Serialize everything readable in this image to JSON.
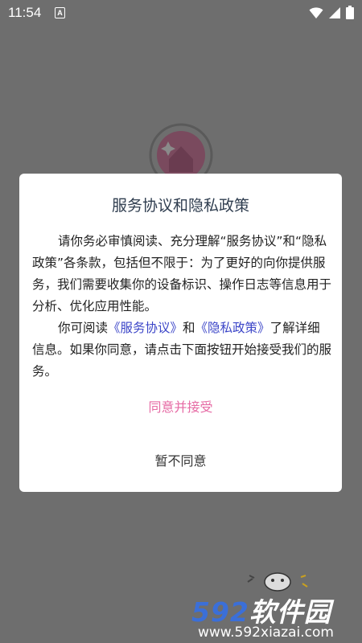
{
  "status_bar": {
    "time": "11:54",
    "notification_badge": "A",
    "icons": [
      "notification-a-icon",
      "wifi-icon",
      "signal-icon",
      "battery-icon"
    ]
  },
  "dialog": {
    "title": "服务协议和隐私政策",
    "para1": "请你务必审慎阅读、充分理解“服务协议”和“隐私政策”各条款，包括但不限于：为了更好的向你提供服务，我们需要收集你的设备标识、操作日志等信息用于分析、优化应用性能。",
    "para2_prefix": "你可阅读",
    "link_service": "《服务协议》",
    "para2_and": "和",
    "link_privacy": "《隐私政策》",
    "para2_suffix": "了解详细信息。如果你同意，请点击下面按钮开始接受我们的服务。",
    "agree_label": "同意并接受",
    "disagree_label": "暂不同意"
  },
  "watermark": {
    "brand_num": "592",
    "brand_text": "软件园",
    "url": "www.592xiazai.com"
  },
  "colors": {
    "overlay": "#6e6e6e",
    "title": "#2f3d4f",
    "link": "#3c46c8",
    "agree": "#e66aa4",
    "logo": "#c44a7e"
  }
}
